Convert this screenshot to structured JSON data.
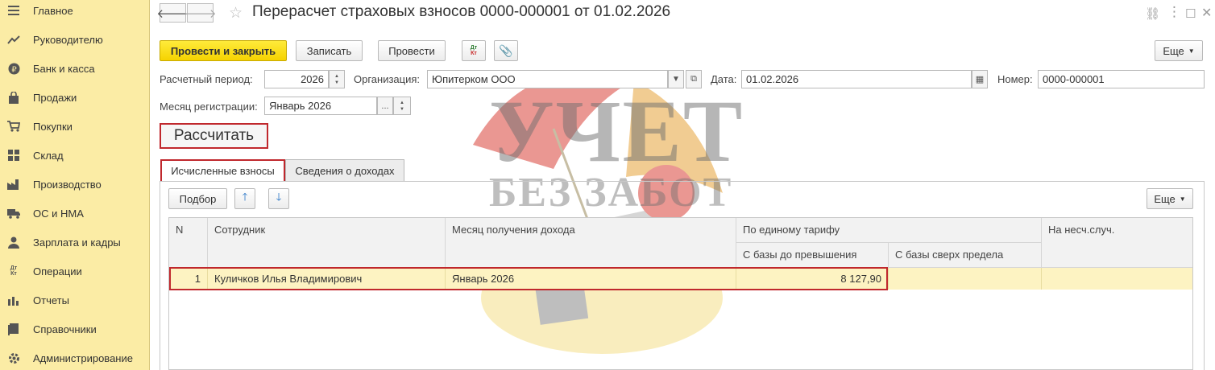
{
  "sidebar": {
    "items": [
      {
        "label": "Главное",
        "icon": "menu-icon"
      },
      {
        "label": "Руководителю",
        "icon": "trend-icon"
      },
      {
        "label": "Банк и касса",
        "icon": "ruble-icon"
      },
      {
        "label": "Продажи",
        "icon": "bag-icon"
      },
      {
        "label": "Покупки",
        "icon": "cart-icon"
      },
      {
        "label": "Склад",
        "icon": "grid-icon"
      },
      {
        "label": "Производство",
        "icon": "factory-icon"
      },
      {
        "label": "ОС и НМА",
        "icon": "truck-icon"
      },
      {
        "label": "Зарплата и кадры",
        "icon": "person-icon"
      },
      {
        "label": "Операции",
        "icon": "dt-kt-icon"
      },
      {
        "label": "Отчеты",
        "icon": "bar-chart-icon"
      },
      {
        "label": "Справочники",
        "icon": "book-icon"
      },
      {
        "label": "Администрирование",
        "icon": "gear-icon"
      }
    ],
    "dtkt_top": "Дт",
    "dtkt_bottom": "Кт"
  },
  "header": {
    "title": "Перерасчет страховых взносов 0000-000001 от 01.02.2026"
  },
  "toolbar": {
    "post_close": "Провести и закрыть",
    "save": "Записать",
    "post": "Провести",
    "dtkt_top": "Дт",
    "dtkt_bottom": "Кт",
    "more": "Еще"
  },
  "form": {
    "period_label": "Расчетный период:",
    "period_value": "2026",
    "org_label": "Организация:",
    "org_value": "Юпитерком ООО",
    "date_label": "Дата:",
    "date_value": "01.02.2026",
    "number_label": "Номер:",
    "number_value": "0000-000001",
    "reg_month_label": "Месяц регистрации:",
    "reg_month_value": "Январь 2026",
    "ellipsis": "..."
  },
  "calculate_button": "Рассчитать",
  "tabs": [
    {
      "label": "Исчисленные взносы",
      "active": true
    },
    {
      "label": "Сведения о доходах",
      "active": false
    }
  ],
  "table_toolbar": {
    "select": "Подбор",
    "more": "Еще"
  },
  "table": {
    "columns": {
      "n": "N",
      "employee": "Сотрудник",
      "income_month": "Месяц получения дохода",
      "unified_rate": "По единому тарифу",
      "base_before": "С базы до превышения",
      "base_over": "С базы сверх предела",
      "accident": "На несч.случ."
    },
    "rows": [
      {
        "n": "1",
        "employee": "Куличков Илья Владимирович",
        "income_month": "Январь 2026",
        "base_before": "8 127,90",
        "base_over": "",
        "accident": ""
      }
    ]
  },
  "watermark": {
    "line1": "УЧЕТ",
    "line2": "БЕЗ ЗАБОТ"
  },
  "colors": {
    "sidebar_bg": "#fbeca5",
    "primary_button": "#f5d200",
    "highlight_border": "#c0282d",
    "selected_row": "#fdf3c2"
  }
}
